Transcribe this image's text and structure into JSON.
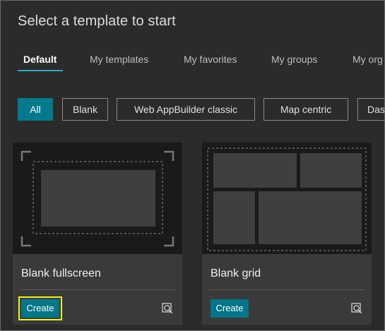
{
  "dialog": {
    "title": "Select a template to start"
  },
  "tabs": [
    {
      "label": "Default",
      "active": true
    },
    {
      "label": "My templates",
      "active": false
    },
    {
      "label": "My favorites",
      "active": false
    },
    {
      "label": "My groups",
      "active": false
    },
    {
      "label": "My org",
      "active": false
    }
  ],
  "filters": [
    {
      "label": "All",
      "active": true
    },
    {
      "label": "Blank",
      "active": false
    },
    {
      "label": "Web AppBuilder classic",
      "active": false
    },
    {
      "label": "Map centric",
      "active": false
    },
    {
      "label": "Dashboard",
      "active": false
    }
  ],
  "templates": [
    {
      "name": "Blank fullscreen",
      "create_label": "Create",
      "preview_icon": "preview-icon",
      "highlighted": true
    },
    {
      "name": "Blank grid",
      "create_label": "Create",
      "preview_icon": "preview-icon",
      "highlighted": false
    }
  ],
  "colors": {
    "accent": "#007a8c",
    "tab_underline": "#2aa8c8",
    "highlight": "#f2ef1a",
    "background": "#2b2b2b",
    "card": "#3a3a3a"
  }
}
